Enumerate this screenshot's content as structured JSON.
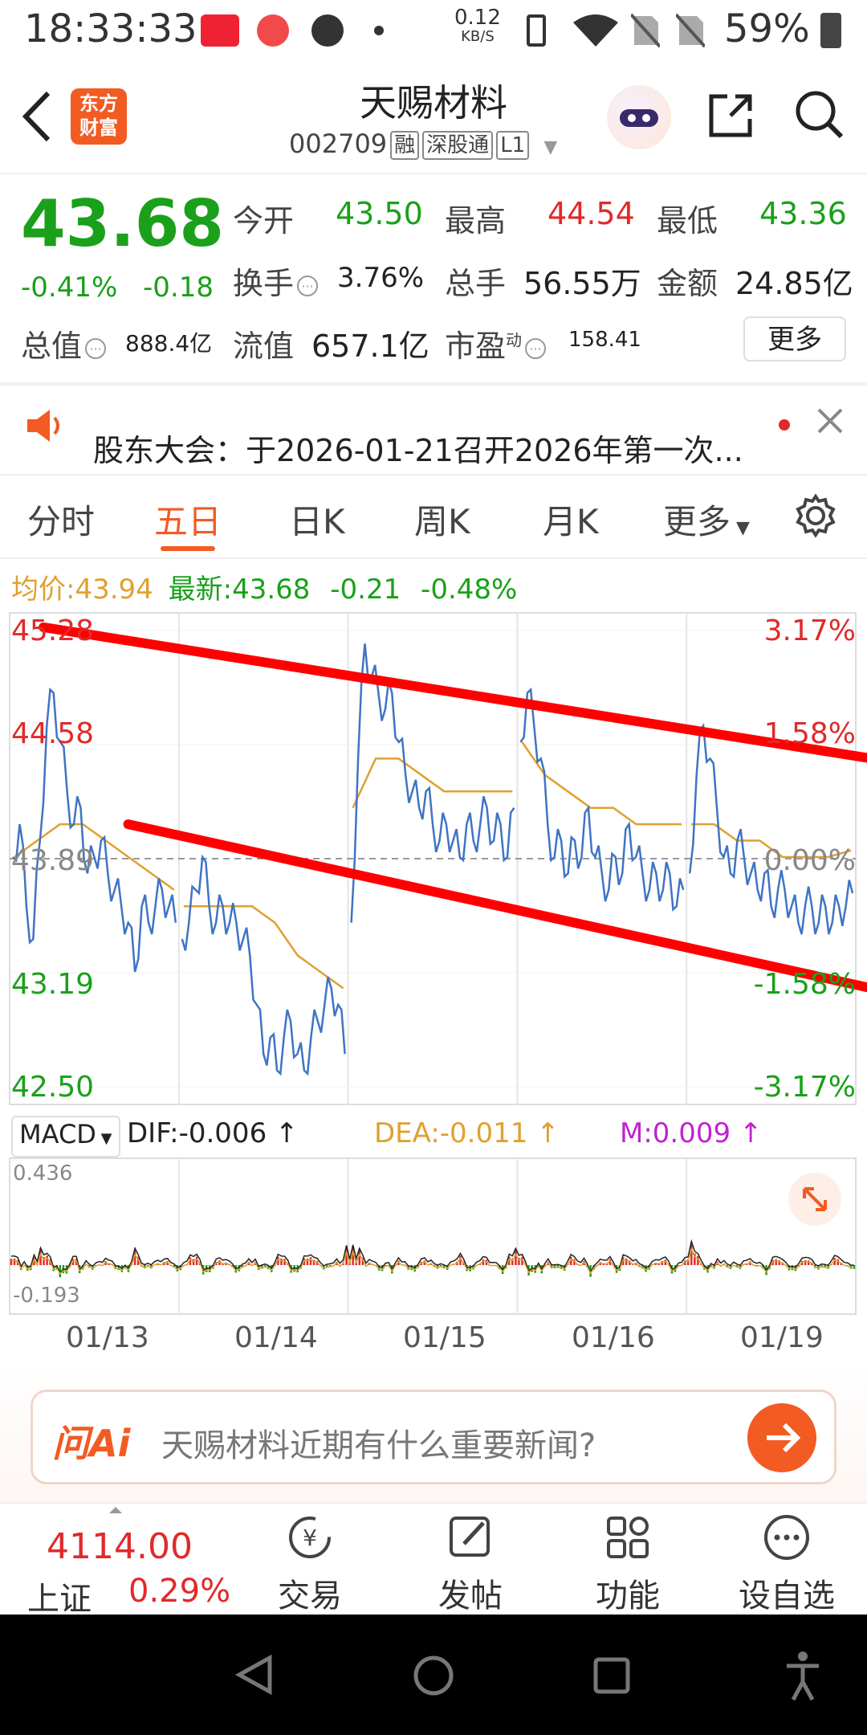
{
  "status_bar": {
    "time": "18:33:33",
    "net_speed_top": "0.12",
    "net_speed_unit": "KB/S",
    "battery": "59%"
  },
  "header": {
    "logo_line1": "东方",
    "logo_line2": "财富",
    "title": "天赐材料",
    "code": "002709",
    "tags": [
      "融",
      "深股通",
      "L1"
    ]
  },
  "quote": {
    "price": "43.68",
    "change_pct": "-0.41%",
    "change": "-0.18",
    "open_label": "今开",
    "open": "43.50",
    "high_label": "最高",
    "high": "44.54",
    "low_label": "最低",
    "low": "43.36",
    "turnover_label": "换手",
    "turnover": "3.76%",
    "volume_label": "总手",
    "volume": "56.55万",
    "amount_label": "金额",
    "amount": "24.85亿",
    "mcap_label": "总值",
    "mcap": "888.4亿",
    "float_label": "流值",
    "float_cap": "657.1亿",
    "pe_label": "市盈",
    "pe_super": "动",
    "pe": "158.41",
    "more_label": "更多"
  },
  "notice": {
    "text": "股东大会：于2026-01-21召开2026年第一次..."
  },
  "tabs": {
    "items": [
      "分时",
      "五日",
      "日K",
      "周K",
      "月K",
      "更多"
    ],
    "active": "五日"
  },
  "avg_info": {
    "avg_label": "均价:",
    "avg": "43.94",
    "latest_label": "最新:",
    "latest": "43.68",
    "chg": "-0.21",
    "chg_pct": "-0.48%"
  },
  "chart_data": {
    "type": "line",
    "title": "",
    "y_ticks_left": [
      "45.28",
      "44.58",
      "43.89",
      "43.19",
      "42.50"
    ],
    "y_ticks_right": [
      "3.17%",
      "1.58%",
      "0.00%",
      "-1.58%",
      "-3.17%"
    ],
    "ylim": [
      42.5,
      45.28
    ],
    "x_labels": [
      "01/13",
      "01/14",
      "01/15",
      "01/16",
      "01/19"
    ],
    "reference_price": 43.89,
    "series": [
      {
        "values_by_day": [
          [
            43.9,
            44.1,
            43.6,
            43.4,
            44.0,
            44.7,
            44.9,
            44.6,
            44.3,
            44.1,
            44.2,
            43.8,
            43.9,
            44.0,
            43.8,
            43.7,
            43.6,
            43.5,
            43.2,
            43.6,
            43.5,
            43.6,
            43.7,
            43.6,
            43.5
          ],
          [
            43.4,
            43.5,
            43.7,
            43.9,
            43.6,
            43.5,
            43.6,
            43.5,
            43.5,
            43.4,
            43.3,
            43.0,
            42.7,
            42.8,
            42.6,
            42.8,
            42.9,
            42.7,
            42.6,
            42.8,
            42.9,
            43.0,
            43.1,
            43.0,
            42.7
          ],
          [
            43.5,
            44.5,
            45.2,
            45.0,
            44.9,
            44.8,
            44.9,
            44.6,
            44.4,
            44.3,
            44.2,
            44.3,
            44.1,
            44.0,
            44.1,
            44.0,
            43.9,
            44.1,
            44.0,
            44.1,
            44.2,
            44.0,
            44.1,
            43.9,
            44.2
          ],
          [
            44.6,
            44.9,
            44.7,
            44.5,
            44.1,
            43.9,
            44.0,
            43.8,
            44.0,
            43.9,
            44.2,
            43.9,
            43.8,
            43.7,
            43.9,
            43.8,
            44.1,
            43.9,
            43.8,
            43.7,
            43.8,
            43.7,
            43.8,
            43.6,
            43.7
          ],
          [
            43.8,
            44.4,
            44.7,
            44.5,
            44.2,
            43.9,
            43.8,
            44.0,
            43.9,
            43.8,
            43.7,
            43.8,
            43.6,
            43.7,
            43.7,
            43.6,
            43.5,
            43.6,
            43.6,
            43.5,
            43.6,
            43.5,
            43.6,
            43.6,
            43.68
          ]
        ],
        "name": ""
      },
      {
        "avg_by_day": [
          [
            43.9,
            44.0,
            44.1,
            44.1,
            44.0,
            43.9,
            43.8,
            43.7
          ],
          [
            43.6,
            43.6,
            43.6,
            43.6,
            43.5,
            43.3,
            43.2,
            43.1
          ],
          [
            44.2,
            44.5,
            44.5,
            44.4,
            44.3,
            44.3,
            44.3,
            44.3
          ],
          [
            44.6,
            44.4,
            44.3,
            44.2,
            44.2,
            44.1,
            44.1,
            44.1
          ],
          [
            44.1,
            44.1,
            44.0,
            44.0,
            43.9,
            43.9,
            43.9,
            43.94
          ]
        ]
      }
    ],
    "trend_lines": [
      {
        "from_day": 0.2,
        "from_value": 45.3,
        "to_day": 5.0,
        "to_value": 44.5
      },
      {
        "from_day": 0.7,
        "from_value": 44.1,
        "to_day": 5.0,
        "to_value": 43.1
      }
    ]
  },
  "macd": {
    "label": "MACD",
    "dif_label": "DIF:",
    "dif": "-0.006",
    "dea_label": "DEA:",
    "dea": "-0.011",
    "m_label": "M:",
    "m": "0.009",
    "arrow": "↑",
    "y_top": "0.436",
    "y_bottom": "-0.193"
  },
  "ask_ai": {
    "logo": "问Ai",
    "placeholder": "天赐材料近期有什么重要新闻?"
  },
  "bottom_bar": {
    "index_value": "4114.00",
    "index_name": "上证",
    "index_pct": "0.29%",
    "items": [
      "交易",
      "发帖",
      "功能",
      "设自选"
    ]
  },
  "colors": {
    "accent": "#f25b22",
    "up": "#e02a2a",
    "down": "#1aa01a",
    "price_line": "#3f74c4",
    "avg_line": "#e0a030",
    "trend": "#ff0000"
  }
}
